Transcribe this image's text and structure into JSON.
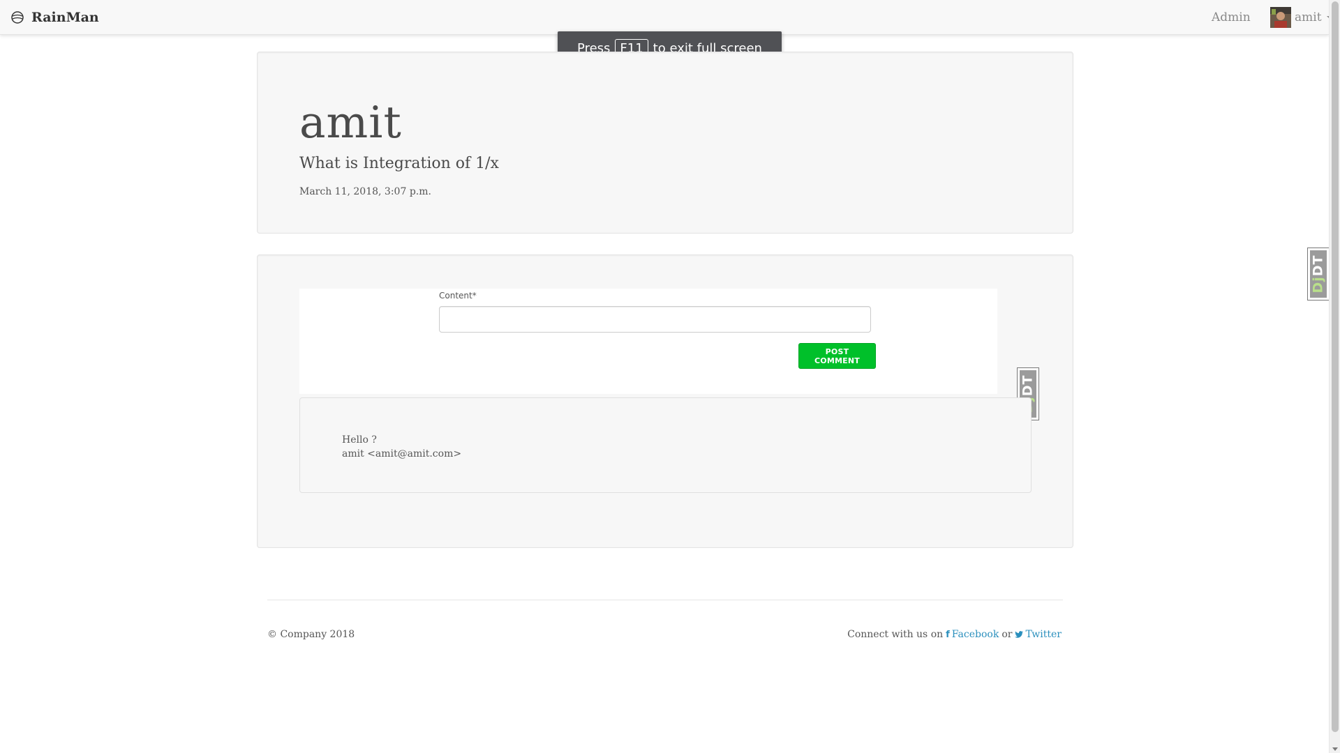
{
  "navbar": {
    "brand": "RainMan",
    "admin_link": "Admin",
    "user_name": "amit"
  },
  "fullscreen_toast": {
    "press": "Press",
    "key": "F11",
    "message": "to exit full screen"
  },
  "post": {
    "author": "amit",
    "title": "What is Integration of 1/x",
    "date": "March 11, 2018, 3:07 p.m."
  },
  "comment_form": {
    "content_label": "Content*",
    "content_value": "",
    "submit_label": "POST COMMENT"
  },
  "comments": [
    {
      "text": "Hello ?",
      "author": "amit <amit@amit.com>"
    }
  ],
  "debug_toolbar": {
    "prefix": "Dj",
    "suffix": "DT"
  },
  "footer": {
    "copyright": "© Company 2018",
    "connect_text": "Connect with us on",
    "facebook": "Facebook",
    "or": "or",
    "twitter": "Twitter"
  },
  "colors": {
    "accent_green": "#00c02a",
    "link_blue": "#2a8fbd",
    "navbar_bg": "#f8f8f8"
  },
  "icons": {
    "brand": "globe-icon",
    "facebook": "facebook-icon",
    "twitter": "twitter-icon"
  }
}
